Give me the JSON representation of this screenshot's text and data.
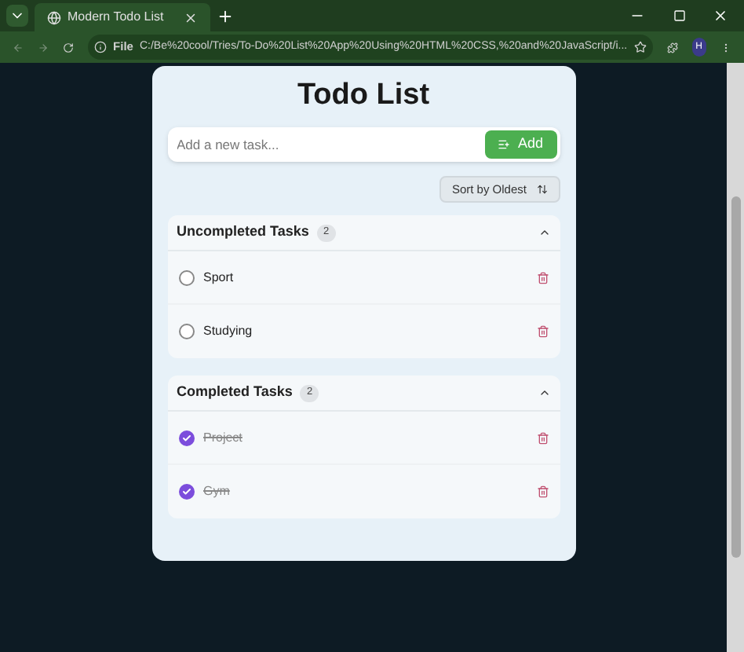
{
  "browser": {
    "tab_title": "Modern Todo List",
    "url_label": "File",
    "url": "C:/Be%20cool/Tries/To-Do%20List%20App%20Using%20HTML%20CSS,%20and%20JavaScript/i...",
    "profile": "H"
  },
  "app": {
    "title": "Todo List",
    "input": {
      "placeholder": "Add a new task..."
    },
    "add_button": "Add",
    "sort_button": "Sort by Oldest"
  },
  "sections": [
    {
      "title": "Uncompleted Tasks",
      "count": "2",
      "expanded": true,
      "tasks": [
        {
          "text": "Sport",
          "done": false
        },
        {
          "text": "Studying",
          "done": false
        }
      ]
    },
    {
      "title": "Completed Tasks",
      "count": "2",
      "expanded": true,
      "tasks": [
        {
          "text": "Project",
          "done": true
        },
        {
          "text": "Gym",
          "done": true
        }
      ]
    }
  ]
}
